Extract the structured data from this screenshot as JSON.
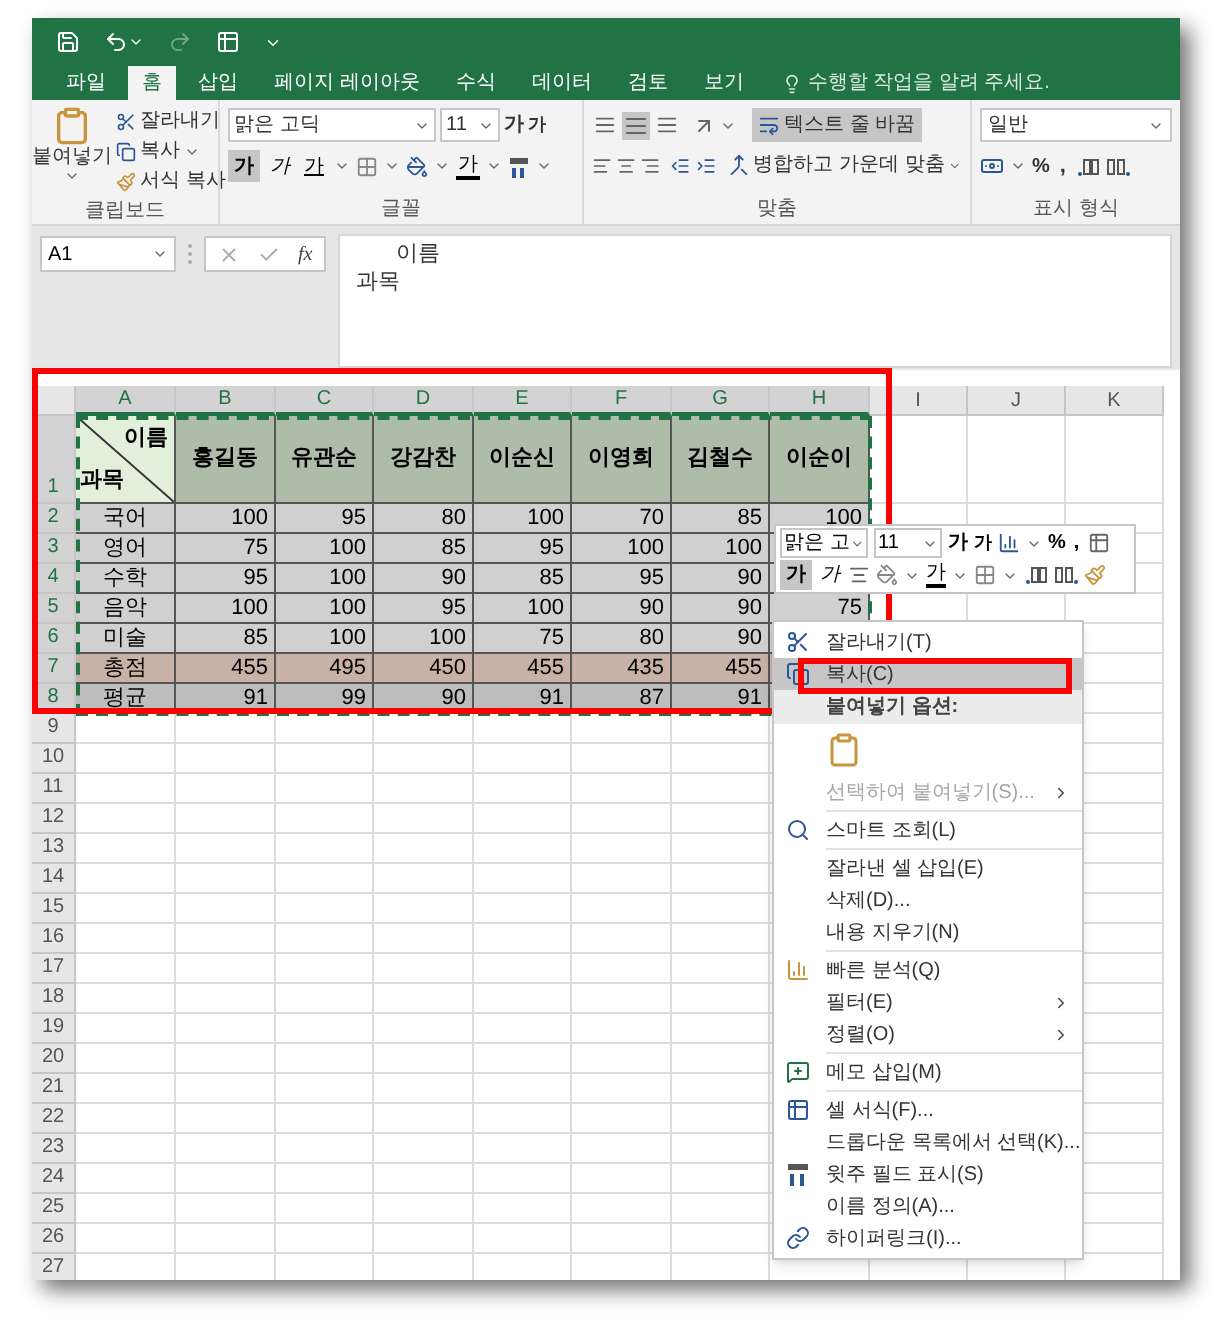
{
  "tabs": [
    {
      "label": "파일",
      "selected": false
    },
    {
      "label": "홈",
      "selected": true
    },
    {
      "label": "삽입",
      "selected": false
    },
    {
      "label": "페이지 레이아웃",
      "selected": false
    },
    {
      "label": "수식",
      "selected": false
    },
    {
      "label": "데이터",
      "selected": false
    },
    {
      "label": "검토",
      "selected": false
    },
    {
      "label": "보기",
      "selected": false
    }
  ],
  "tell_me": "수행할 작업을 알려 주세요.",
  "clipboard": {
    "label": "클립보드",
    "paste": "붙여넣기",
    "cut": "잘라내기",
    "copy": "복사",
    "format_painter": "서식 복사"
  },
  "font": {
    "label": "글꼴",
    "font_name": "맑은 고딕",
    "font_size": "11",
    "grow": "가",
    "shrink": "가",
    "bold": "가",
    "bold_active": true,
    "italic": "가",
    "underline": "가",
    "font_color": "가"
  },
  "alignment": {
    "label": "맞춤",
    "middle_align_active": true,
    "wrap_text": "텍스트 줄 바꿈",
    "wrap_text_active": true,
    "merge_center": "병합하고 가운데 맞춤"
  },
  "number": {
    "label": "표시 형식",
    "format": "일반",
    "percent": "%",
    "comma": ","
  },
  "formula_bar": {
    "name_box": "A1",
    "fx": "fx",
    "lines": [
      "이름",
      "과목"
    ]
  },
  "sheet": {
    "columns": [
      {
        "label": "A",
        "selected": true
      },
      {
        "label": "B",
        "selected": true
      },
      {
        "label": "C",
        "selected": true
      },
      {
        "label": "D",
        "selected": true
      },
      {
        "label": "E",
        "selected": true
      },
      {
        "label": "F",
        "selected": true
      },
      {
        "label": "G",
        "selected": true
      },
      {
        "label": "H",
        "selected": true
      },
      {
        "label": "I",
        "selected": false
      },
      {
        "label": "J",
        "selected": false
      },
      {
        "label": "K",
        "selected": false
      }
    ],
    "row_numbers": [
      {
        "label": "1",
        "selected": true
      },
      {
        "label": "2",
        "selected": true
      },
      {
        "label": "3",
        "selected": true
      },
      {
        "label": "4",
        "selected": true
      },
      {
        "label": "5",
        "selected": true
      },
      {
        "label": "6",
        "selected": true
      },
      {
        "label": "7",
        "selected": true
      },
      {
        "label": "8",
        "selected": true
      },
      {
        "label": "9",
        "selected": false
      },
      {
        "label": "10",
        "selected": false
      },
      {
        "label": "11",
        "selected": false
      },
      {
        "label": "12",
        "selected": false
      },
      {
        "label": "13",
        "selected": false
      },
      {
        "label": "14",
        "selected": false
      },
      {
        "label": "15",
        "selected": false
      },
      {
        "label": "16",
        "selected": false
      },
      {
        "label": "17",
        "selected": false
      },
      {
        "label": "18",
        "selected": false
      },
      {
        "label": "19",
        "selected": false
      },
      {
        "label": "20",
        "selected": false
      },
      {
        "label": "21",
        "selected": false
      },
      {
        "label": "22",
        "selected": false
      },
      {
        "label": "23",
        "selected": false
      },
      {
        "label": "24",
        "selected": false
      },
      {
        "label": "25",
        "selected": false
      },
      {
        "label": "26",
        "selected": false
      },
      {
        "label": "27",
        "selected": false
      }
    ]
  },
  "table": {
    "corner_top": "이름",
    "corner_bottom": "과목",
    "names": [
      "홍길동",
      "유관순",
      "강감찬",
      "이순신",
      "이영희",
      "김철수",
      "이순이"
    ],
    "rows": [
      {
        "kind": "data",
        "cells": [
          "국어",
          "100",
          "95",
          "80",
          "100",
          "70",
          "85",
          "100"
        ]
      },
      {
        "kind": "data",
        "cells": [
          "영어",
          "75",
          "100",
          "85",
          "95",
          "100",
          "100"
        ]
      },
      {
        "kind": "data",
        "cells": [
          "수학",
          "95",
          "100",
          "90",
          "85",
          "95",
          "90"
        ]
      },
      {
        "kind": "data",
        "cells": [
          "음악",
          "100",
          "100",
          "95",
          "100",
          "90",
          "90",
          "75"
        ]
      },
      {
        "kind": "data",
        "cells": [
          "미술",
          "85",
          "100",
          "100",
          "75",
          "80",
          "90"
        ]
      },
      {
        "kind": "total",
        "cells": [
          "총점",
          "455",
          "495",
          "450",
          "455",
          "435",
          "455"
        ]
      },
      {
        "kind": "average",
        "cells": [
          "평균",
          "91",
          "99",
          "90",
          "91",
          "87",
          "91"
        ]
      }
    ]
  },
  "mini_toolbar": {
    "font_name": "맑은 고",
    "font_size": "11",
    "grow": "가",
    "shrink": "가",
    "percent": "%",
    "comma": ",",
    "bold": "가",
    "bold_active": true,
    "italic": "가",
    "font_color": "가"
  },
  "context_menu": [
    {
      "kind": "item",
      "label": "잘라내기(T)",
      "selected": false,
      "disabled": false
    },
    {
      "kind": "item",
      "label": "복사(C)",
      "selected": true,
      "disabled": false
    },
    {
      "kind": "header",
      "label": "붙여넣기 옵션:"
    },
    {
      "kind": "paste_options"
    },
    {
      "kind": "item",
      "label": "선택하여 붙여넣기(S)...",
      "selected": false,
      "disabled": true,
      "submenu": true
    },
    {
      "kind": "separator"
    },
    {
      "kind": "item",
      "label": "스마트 조회(L)",
      "selected": false,
      "disabled": false
    },
    {
      "kind": "separator"
    },
    {
      "kind": "item",
      "label": "잘라낸 셀 삽입(E)",
      "selected": false,
      "disabled": false
    },
    {
      "kind": "item",
      "label": "삭제(D)...",
      "selected": false,
      "disabled": false
    },
    {
      "kind": "item",
      "label": "내용 지우기(N)",
      "selected": false,
      "disabled": false
    },
    {
      "kind": "separator"
    },
    {
      "kind": "item",
      "label": "빠른 분석(Q)",
      "selected": false,
      "disabled": false
    },
    {
      "kind": "item",
      "label": "필터(E)",
      "selected": false,
      "disabled": false,
      "submenu": true
    },
    {
      "kind": "item",
      "label": "정렬(O)",
      "selected": false,
      "disabled": false,
      "submenu": true
    },
    {
      "kind": "separator"
    },
    {
      "kind": "item",
      "label": "메모 삽입(M)",
      "selected": false,
      "disabled": false
    },
    {
      "kind": "separator"
    },
    {
      "kind": "item",
      "label": "셀 서식(F)...",
      "selected": false,
      "disabled": false
    },
    {
      "kind": "item",
      "label": "드롭다운 목록에서 선택(K)...",
      "selected": false,
      "disabled": false
    },
    {
      "kind": "item",
      "label": "윗주 필드 표시(S)",
      "selected": false,
      "disabled": false
    },
    {
      "kind": "item",
      "label": "이름 정의(A)...",
      "selected": false,
      "disabled": false
    },
    {
      "kind": "item",
      "label": "하이퍼링크(I)...",
      "selected": false,
      "disabled": false
    }
  ]
}
